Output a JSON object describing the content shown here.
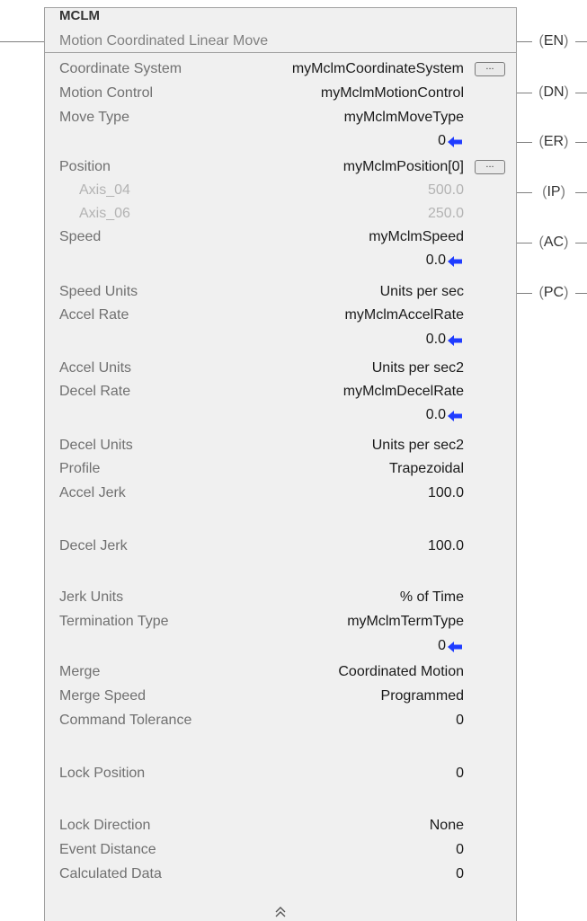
{
  "block": {
    "name": "MCLM",
    "description": "Motion Coordinated Linear Move"
  },
  "params": [
    {
      "label": "Coordinate System",
      "value": "myMclmCoordinateSystem",
      "has_browse": true
    },
    {
      "label": "Motion Control",
      "value": "myMclmMotionControl"
    },
    {
      "label": "Move Type",
      "value": "myMclmMoveType",
      "live_value": "0"
    },
    {
      "label": "Position",
      "value": "myMclmPosition[0]",
      "has_browse": true
    },
    {
      "label": "Axis_04",
      "value": "500.0",
      "sub": true
    },
    {
      "label": "Axis_06",
      "value": "250.0",
      "sub": true
    },
    {
      "label": "Speed",
      "value": "myMclmSpeed",
      "live_value": "0.0"
    },
    {
      "label": "Speed Units",
      "value": "Units per sec"
    },
    {
      "label": "Accel Rate",
      "value": "myMclmAccelRate",
      "live_value": "0.0"
    },
    {
      "label": "Accel Units",
      "value": "Units per sec2"
    },
    {
      "label": "Decel Rate",
      "value": "myMclmDecelRate",
      "live_value": "0.0"
    },
    {
      "label": "Decel Units",
      "value": "Units per sec2"
    },
    {
      "label": "Profile",
      "value": "Trapezoidal"
    },
    {
      "label": "Accel Jerk",
      "value": "100.0"
    },
    {
      "label": "Decel Jerk",
      "value": "100.0"
    },
    {
      "label": "Jerk Units",
      "value": "% of Time"
    },
    {
      "label": "Termination Type",
      "value": "myMclmTermType",
      "live_value": "0"
    },
    {
      "label": "Merge",
      "value": "Coordinated Motion"
    },
    {
      "label": "Merge Speed",
      "value": "Programmed"
    },
    {
      "label": "Command Tolerance",
      "value": "0"
    },
    {
      "label": "Lock Position",
      "value": "0"
    },
    {
      "label": "Lock Direction",
      "value": "None"
    },
    {
      "label": "Event Distance",
      "value": "0"
    },
    {
      "label": "Calculated Data",
      "value": "0"
    }
  ],
  "outputs": [
    "EN",
    "DN",
    "ER",
    "IP",
    "AC",
    "PC"
  ],
  "icons": {
    "live_value_arrow": "left-arrow-icon",
    "browse": "ellipsis-icon",
    "collapse": "double-chevron-up-icon"
  },
  "colors": {
    "arrow": "#1f3cff",
    "label": "#707070",
    "dim": "#b3b3b3"
  },
  "browse_label": "..."
}
